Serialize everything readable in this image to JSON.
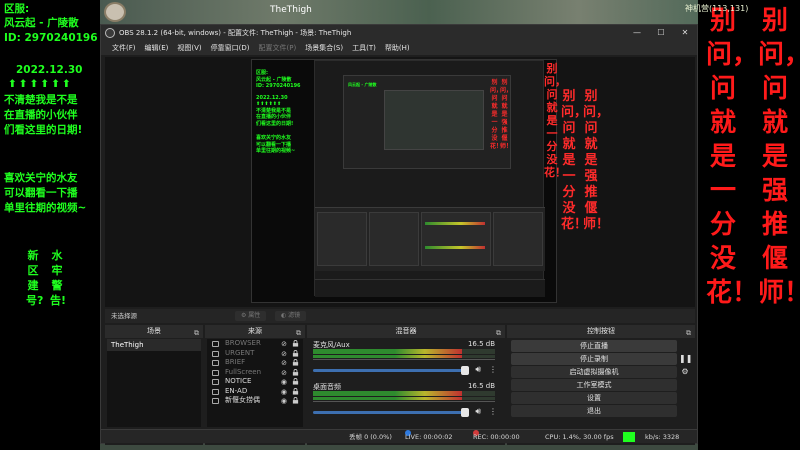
{
  "stream_overlay": {
    "left": {
      "server_label": "区服:",
      "server_name": "风云起 - 广陵散",
      "id_line": "ID: 2970240196",
      "date": "2022.12.30",
      "arrows": "⬆⬆⬆⬆⬆⬆",
      "notice_lines": [
        "不清楚我是不是",
        "在直播的小伙伴",
        "们看这里的日期!"
      ],
      "fans_lines": [
        "喜欢关宁的水友",
        "可以翻看一下播",
        "单里往期的视频~"
      ],
      "col1": "新区建号?",
      "col2": "水牢警告!"
    },
    "right": {
      "col1": "别问，问就是一分没花！",
      "col2": "别问，问就是强推偃师！"
    },
    "game": {
      "player_name": "TheThigh",
      "coords": "神机营(113,131)"
    }
  },
  "window": {
    "title": "OBS 28.1.2 (64-bit, windows) - 配置文件: TheThigh - 场景: TheThigh",
    "minimize": "—",
    "maximize": "☐",
    "close": "✕"
  },
  "menu": [
    "文件(F)",
    "编辑(E)",
    "视图(V)",
    "停靠窗口(D)",
    "配置文件(P)",
    "场景集合(S)",
    "工具(T)",
    "帮助(H)"
  ],
  "source_toolbar": {
    "no_source": "未选择源",
    "properties": "属性",
    "filters": "滤镜"
  },
  "docks": {
    "scenes": {
      "title": "场景",
      "items": [
        "TheThigh"
      ]
    },
    "sources": {
      "title": "来源",
      "items": [
        {
          "name": "BROWSER",
          "visible": false
        },
        {
          "name": "URGENT",
          "visible": false
        },
        {
          "name": "BRIEF",
          "visible": false
        },
        {
          "name": "FullScreen",
          "visible": false
        },
        {
          "name": "NOTICE",
          "visible": true
        },
        {
          "name": "EN-AD",
          "visible": true
        },
        {
          "name": "新偃女捞偶",
          "visible": true
        }
      ]
    },
    "mixer": {
      "title": "混音器",
      "tracks": [
        {
          "name": "麦克风/Aux",
          "db": "16.5 dB",
          "level": 0.82
        },
        {
          "name": "桌面音频",
          "db": "16.5 dB",
          "level": 0.82
        }
      ],
      "scale": "-60 -55 -50 -45 -40 -35 -30 -25 -20 -15 -10 -5 0"
    },
    "controls": {
      "title": "控制按钮",
      "buttons": [
        "停止直播",
        "停止录制",
        "启动虚拟摄像机",
        "工作室模式",
        "设置",
        "退出"
      ]
    }
  },
  "statusbar": {
    "dropped": "丢帧 0 (0.0%)",
    "live": "LIVE: 00:00:02",
    "rec": "REC: 00:00:00",
    "cpu": "CPU: 1.4%, 30.00 fps",
    "bitrate": "kb/s: 3328"
  },
  "colors": {
    "overlay_green": "#1fff1f",
    "overlay_red": "#ff1a1a",
    "obs_bg": "#1e1e1e",
    "live_blue": "#2f7be0",
    "rec_red": "#d23b3b"
  }
}
